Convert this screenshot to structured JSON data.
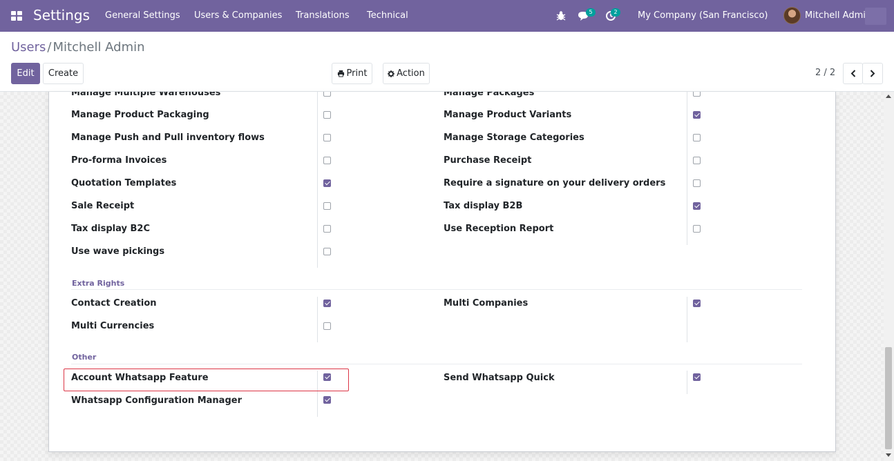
{
  "navbar": {
    "app_title": "Settings",
    "menu": [
      "General Settings",
      "Users & Companies",
      "Translations",
      "Technical"
    ],
    "messages_count": "5",
    "activities_count": "2",
    "company": "My Company (San Francisco)",
    "user": "Mitchell Admin"
  },
  "breadcrumb": {
    "parent": "Users",
    "separator": "/",
    "current": "Mitchell Admin"
  },
  "toolbar": {
    "edit": "Edit",
    "create": "Create",
    "print": "Print",
    "action": "Action"
  },
  "pager": {
    "value": "2 / 2"
  },
  "top_rows": {
    "left": [
      {
        "label": "Manage Multiple Warehouses",
        "checked": false
      },
      {
        "label": "Manage Product Packaging",
        "checked": false
      },
      {
        "label": "Manage Push and Pull inventory flows",
        "checked": false
      },
      {
        "label": "Pro-forma Invoices",
        "checked": false
      },
      {
        "label": "Quotation Templates",
        "checked": true
      },
      {
        "label": "Sale Receipt",
        "checked": false
      },
      {
        "label": "Tax display B2C",
        "checked": false
      },
      {
        "label": "Use wave pickings",
        "checked": false
      }
    ],
    "right": [
      {
        "label": "Manage Packages",
        "checked": false
      },
      {
        "label": "Manage Product Variants",
        "checked": true
      },
      {
        "label": "Manage Storage Categories",
        "checked": false
      },
      {
        "label": "Purchase Receipt",
        "checked": false
      },
      {
        "label": "Require a signature on your delivery orders",
        "checked": false
      },
      {
        "label": "Tax display B2B",
        "checked": true
      },
      {
        "label": "Use Reception Report",
        "checked": false
      }
    ]
  },
  "extra_rights": {
    "title": "Extra Rights",
    "left": [
      {
        "label": "Contact Creation",
        "checked": true
      },
      {
        "label": "Multi Currencies",
        "checked": false
      }
    ],
    "right": [
      {
        "label": "Multi Companies",
        "checked": true
      }
    ]
  },
  "other": {
    "title": "Other",
    "left": [
      {
        "label": "Account Whatsapp Feature",
        "checked": true
      },
      {
        "label": "Whatsapp Configuration Manager",
        "checked": true
      }
    ],
    "right": [
      {
        "label": "Send Whatsapp Quick",
        "checked": true
      }
    ]
  },
  "colors": {
    "brand": "#71639e",
    "highlight": "#dc3545",
    "badge": "#00a09d"
  }
}
